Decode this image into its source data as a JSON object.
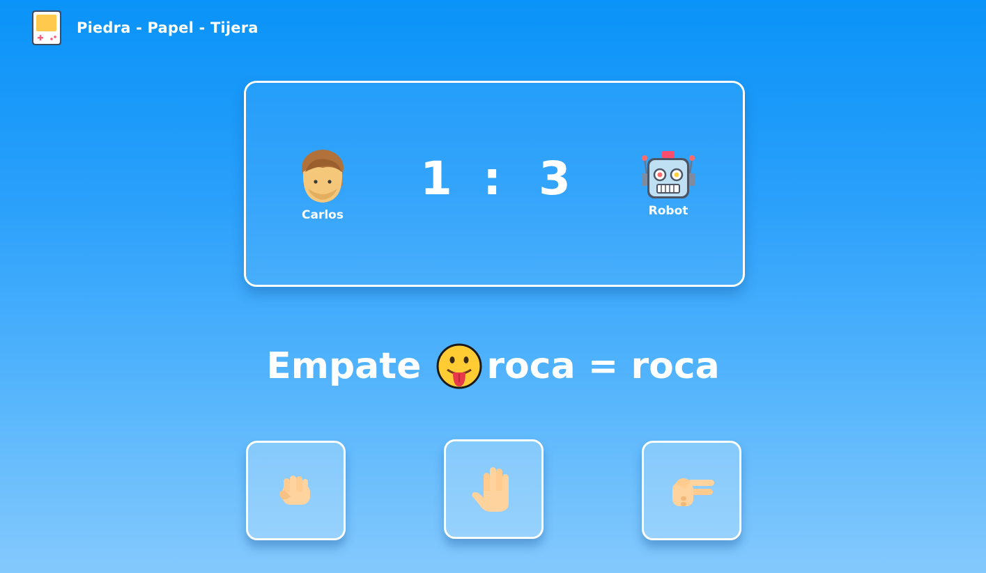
{
  "header": {
    "title": "Piedra - Papel - Tijera",
    "logo_icon": "gameboy-icon"
  },
  "scoreboard": {
    "player": {
      "name": "Carlos",
      "avatar": "man-face-icon",
      "score": "1"
    },
    "separator": ":",
    "opponent": {
      "name": "Robot",
      "avatar": "robot-face-icon",
      "score": "3"
    }
  },
  "result": {
    "text": "Empate",
    "emoji": "tongue-out-face-icon",
    "detail": "roca = roca"
  },
  "choices": [
    {
      "id": "rock",
      "icon": "fist-icon"
    },
    {
      "id": "paper",
      "icon": "open-hand-icon"
    },
    {
      "id": "scissors",
      "icon": "victory-hand-icon"
    }
  ],
  "colors": {
    "background_top": "#0a93f8",
    "background_bottom": "#84c9fd",
    "foreground": "#ffffff",
    "skin": "#ffd39e"
  }
}
